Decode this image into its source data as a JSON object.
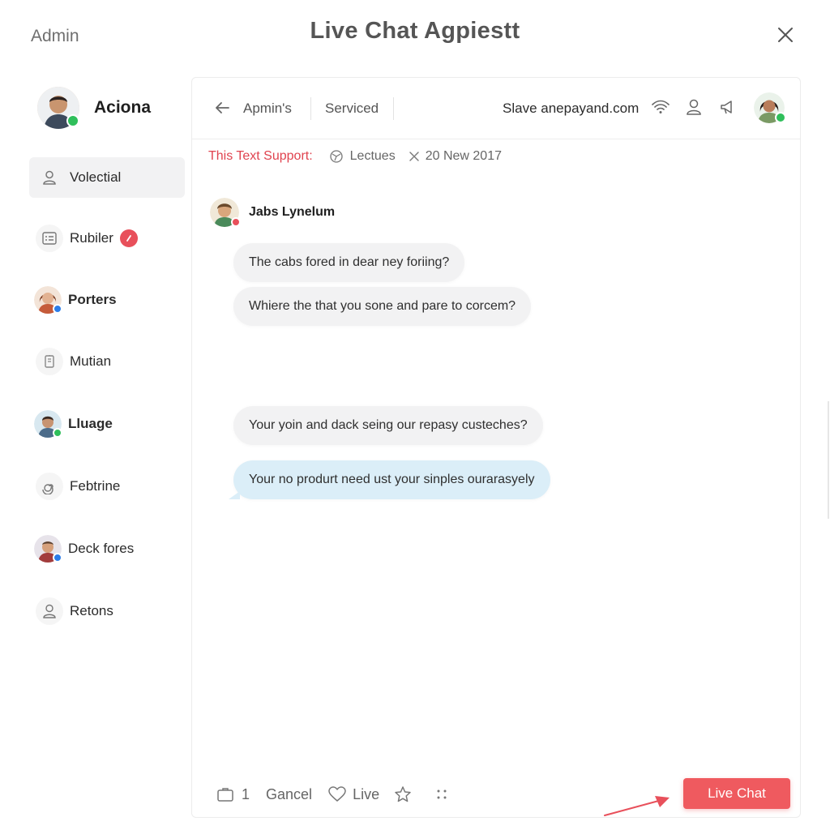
{
  "window": {
    "admin_label": "Admin",
    "title": "Live Chat Agpiestt",
    "close_icon": "close-icon"
  },
  "sidebar": {
    "profile": {
      "name": "Aciona",
      "status_color": "#2fbf5b"
    },
    "items": [
      {
        "label": "Volectial",
        "icon": "user-icon",
        "active": true
      },
      {
        "label": "Rubiler",
        "icon": "list-icon",
        "badge": true
      },
      {
        "label": "Porters",
        "icon": "avatar"
      },
      {
        "label": "Mutian",
        "icon": "document-icon"
      },
      {
        "label": "Lluage",
        "icon": "avatar"
      },
      {
        "label": "Febtrine",
        "icon": "spiral-icon"
      },
      {
        "label": "Deck fores",
        "icon": "avatar"
      },
      {
        "label": "Retons",
        "icon": "user-icon"
      }
    ]
  },
  "chat_header": {
    "back_label": "Apmin's",
    "tab_label": "Serviced",
    "site": "Slave anepayand.com",
    "icons": [
      "wifi-icon",
      "user-icon",
      "megaphone-icon"
    ]
  },
  "subbar": {
    "support_label": "This Text Support:",
    "tag": "Lectues",
    "date": "20 New 2017"
  },
  "conversation": {
    "sender": "Jabs Lynelum",
    "messages": [
      {
        "text": "The cabs fored in dear ney foriing?",
        "style": "gray"
      },
      {
        "text": "Whiere the that you sone and pare to corcem?",
        "style": "gray"
      },
      {
        "text": "Your yoin and dack seing our repasy custeches?",
        "style": "gray"
      },
      {
        "text": "Your no produrt need ust your sinples ourarasyely",
        "style": "blue"
      }
    ]
  },
  "footer": {
    "count": "1",
    "cancel": "Gancel",
    "live": "Live",
    "live_chat_button": "Live Chat"
  },
  "colors": {
    "accent": "#ef5a5f",
    "support_red": "#e0434f",
    "bubble_gray": "#f2f2f3",
    "bubble_blue": "#dbeef8",
    "online_green": "#2fbf5b",
    "verified_blue": "#2b7de9"
  }
}
